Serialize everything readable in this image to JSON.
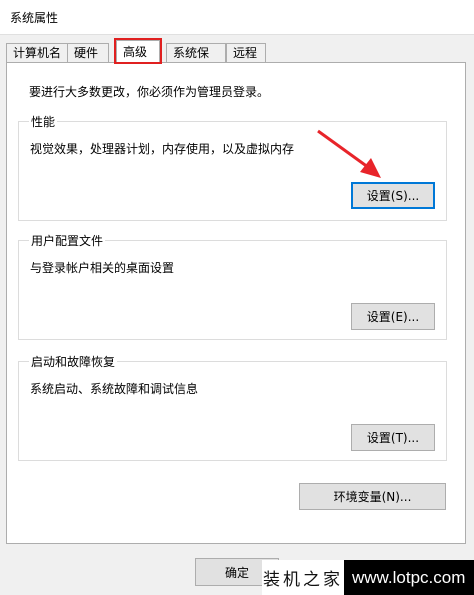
{
  "window": {
    "title": "系统属性"
  },
  "tabs": [
    {
      "label": "计算机名",
      "active": false
    },
    {
      "label": "硬件",
      "active": false
    },
    {
      "label": "高级",
      "active": true
    },
    {
      "label": "系统保护",
      "active": false
    },
    {
      "label": "远程",
      "active": false
    }
  ],
  "advanced": {
    "admin_notice": "要进行大多数更改，你必须作为管理员登录。",
    "performance": {
      "label": "性能",
      "description": "视觉效果，处理器计划，内存使用，以及虚拟内存",
      "settings_button": "设置(S)..."
    },
    "user_profiles": {
      "label": "用户配置文件",
      "description": "与登录帐户相关的桌面设置",
      "settings_button": "设置(E)..."
    },
    "startup_recovery": {
      "label": "启动和故障恢复",
      "description": "系统启动、系统故障和调试信息",
      "settings_button": "设置(T)..."
    },
    "env_vars_button": "环境变量(N)..."
  },
  "footer": {
    "ok_button": "确定"
  },
  "watermark": {
    "left_text": "装机之家",
    "right_text": "www.lotpc.com"
  },
  "colors": {
    "highlight_red": "#e02020",
    "focus_blue": "#0078d7",
    "arrow_red": "#e8242a"
  }
}
